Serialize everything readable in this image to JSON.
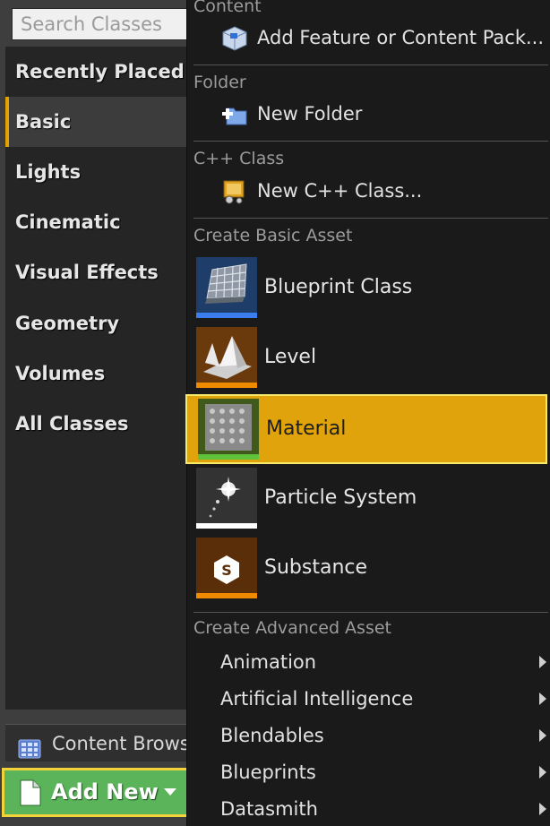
{
  "place_panel": {
    "search": {
      "placeholder": "Search Classes"
    },
    "categories": [
      {
        "label": "Recently Placed",
        "selected": false
      },
      {
        "label": "Basic",
        "selected": true
      },
      {
        "label": "Lights",
        "selected": false
      },
      {
        "label": "Cinematic",
        "selected": false
      },
      {
        "label": "Visual Effects",
        "selected": false
      },
      {
        "label": "Geometry",
        "selected": false
      },
      {
        "label": "Volumes",
        "selected": false
      },
      {
        "label": "All Classes",
        "selected": false
      }
    ],
    "accent_color": "#e0a300"
  },
  "content_browser": {
    "tab_label": "Content Brows",
    "icon": "content-browser-icon",
    "add_new": {
      "label": "Add New",
      "icon": "document-icon",
      "color": "#5bb35a",
      "outline": "#f2d33a"
    }
  },
  "menu": {
    "content": {
      "header": "Content",
      "item": {
        "label": "Add Feature or Content Pack...",
        "icon": "content-pack-icon"
      }
    },
    "folder": {
      "header": "Folder",
      "item": {
        "label": "New Folder",
        "icon": "new-folder-icon"
      }
    },
    "cpp": {
      "header": "C++ Class",
      "item": {
        "label": "New C++ Class...",
        "icon": "cpp-class-icon"
      }
    },
    "basic": {
      "header": "Create Basic Asset",
      "items": [
        {
          "label": "Blueprint Class",
          "icon": "blueprint-class-icon",
          "stripe": "#3b7ded",
          "highlighted": false
        },
        {
          "label": "Level",
          "icon": "level-icon",
          "stripe": "#f08a00",
          "highlighted": false
        },
        {
          "label": "Material",
          "icon": "material-icon",
          "stripe": "#5ec23a",
          "highlighted": true
        },
        {
          "label": "Particle System",
          "icon": "particle-system-icon",
          "stripe": "#ffffff",
          "highlighted": false
        },
        {
          "label": "Substance",
          "icon": "substance-icon",
          "stripe": "#f08a00",
          "highlighted": false
        }
      ]
    },
    "advanced": {
      "header": "Create Advanced Asset",
      "items": [
        {
          "label": "Animation"
        },
        {
          "label": "Artificial Intelligence"
        },
        {
          "label": "Blendables"
        },
        {
          "label": "Blueprints"
        },
        {
          "label": "Datasmith"
        }
      ]
    },
    "highlight_color": "#e0a30c"
  }
}
